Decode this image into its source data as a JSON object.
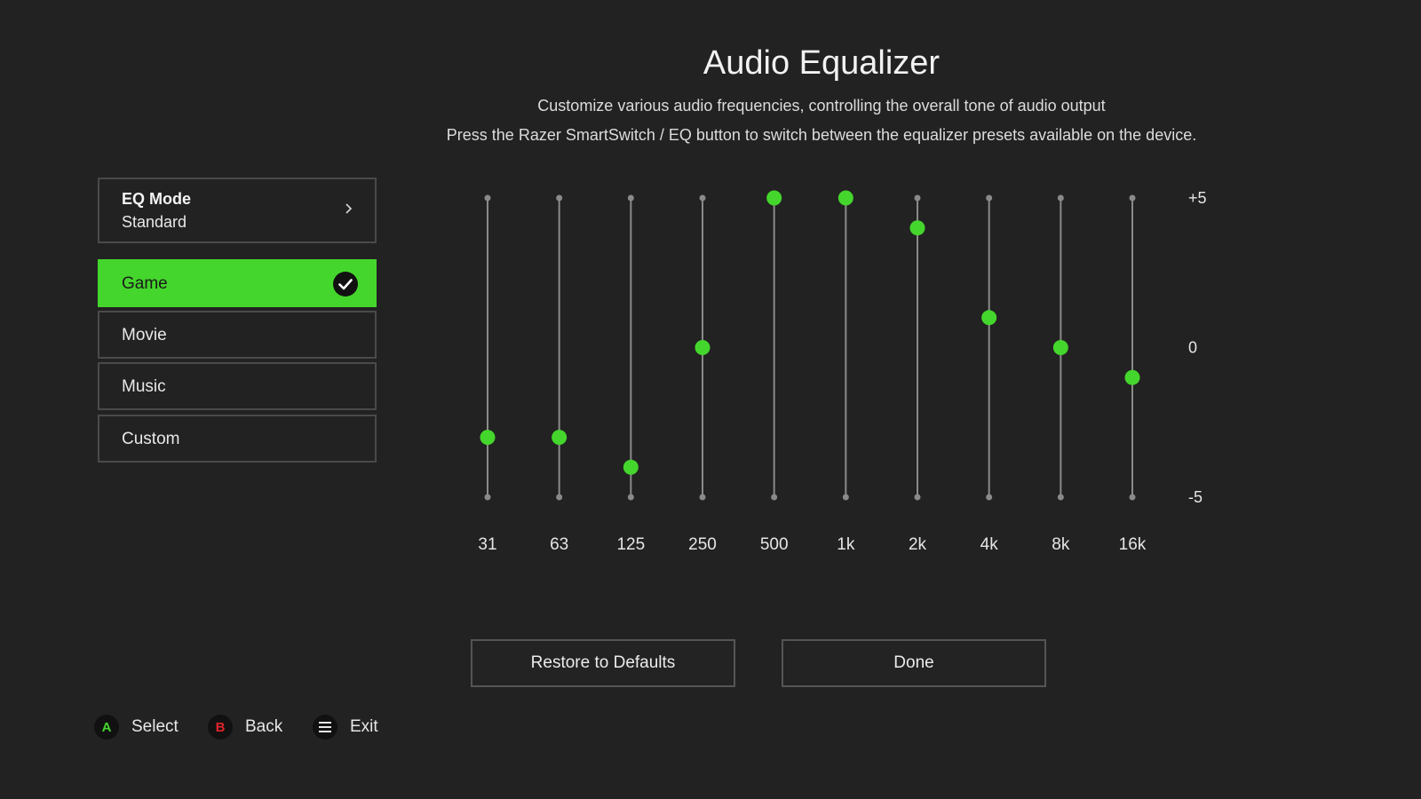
{
  "header": {
    "title": "Audio Equalizer",
    "subtitle_1": "Customize various audio frequencies, controlling the overall tone of audio output",
    "subtitle_2": "Press the Razer SmartSwitch / EQ button to switch between the equalizer presets available on the device."
  },
  "eq_mode": {
    "label": "EQ Mode",
    "value": "Standard"
  },
  "presets": [
    {
      "label": "Game",
      "selected": true
    },
    {
      "label": "Movie",
      "selected": false
    },
    {
      "label": "Music",
      "selected": false
    },
    {
      "label": "Custom",
      "selected": false
    }
  ],
  "equalizer": {
    "scale_labels": {
      "max": "+5",
      "mid": "0",
      "min": "-5"
    },
    "range": [
      -5,
      5
    ],
    "bands": [
      {
        "freq": "31",
        "gain": -3
      },
      {
        "freq": "63",
        "gain": -3
      },
      {
        "freq": "125",
        "gain": -4
      },
      {
        "freq": "250",
        "gain": 0
      },
      {
        "freq": "500",
        "gain": 5
      },
      {
        "freq": "1k",
        "gain": 5
      },
      {
        "freq": "2k",
        "gain": 4
      },
      {
        "freq": "4k",
        "gain": 1
      },
      {
        "freq": "8k",
        "gain": 0
      },
      {
        "freq": "16k",
        "gain": -1
      }
    ],
    "accent_color": "#44d62c",
    "track_color": "#8a8a8a"
  },
  "buttons": {
    "restore": "Restore to Defaults",
    "done": "Done"
  },
  "controller_hints": [
    {
      "key": "A",
      "label": "Select",
      "color": "#44d62c"
    },
    {
      "key": "B",
      "label": "Back",
      "color": "#e0232a"
    },
    {
      "key": "menu-icon",
      "label": "Exit",
      "color": "#e8e8e8"
    }
  ]
}
